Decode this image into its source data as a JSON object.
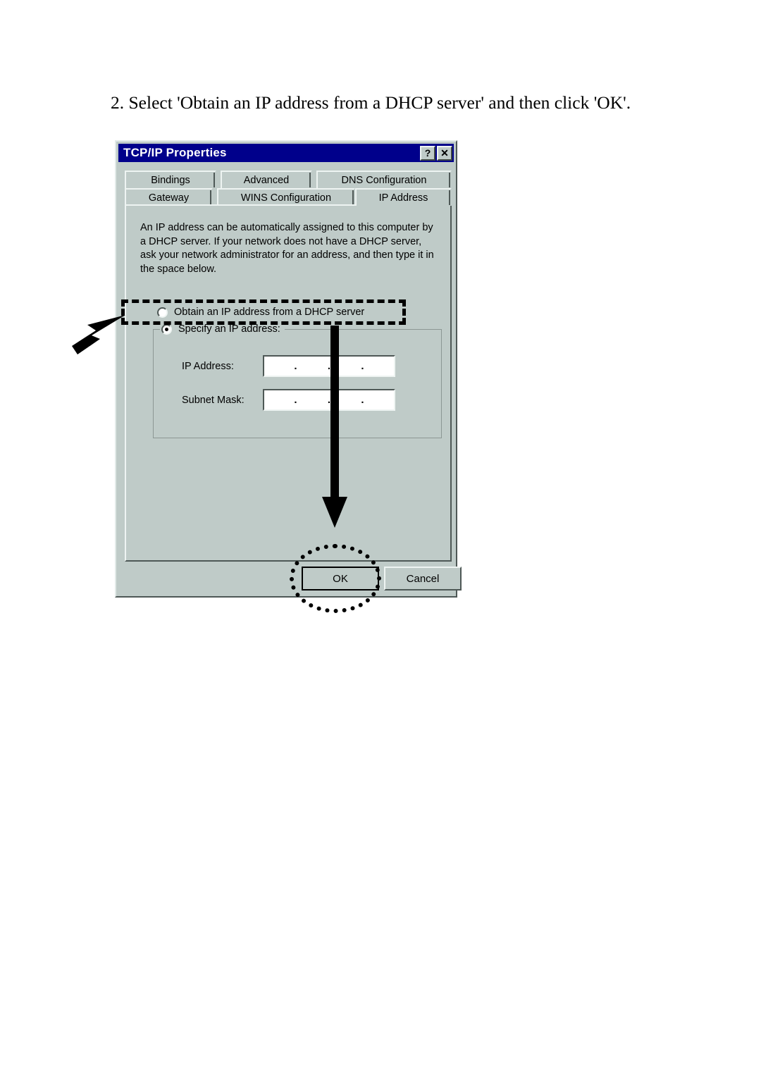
{
  "page": {
    "instruction": "2. Select 'Obtain an IP address from a DHCP server' and then click 'OK'."
  },
  "dialog": {
    "title": "TCP/IP Properties",
    "titlebar_buttons": [
      {
        "name": "help-button",
        "glyph": "?"
      },
      {
        "name": "close-button",
        "glyph": "✕"
      }
    ],
    "tabs": {
      "row1": [
        {
          "label": "Bindings",
          "active": false
        },
        {
          "label": "Advanced",
          "active": false
        },
        {
          "label": "DNS Configuration",
          "active": false
        }
      ],
      "row2": [
        {
          "label": "Gateway",
          "active": false
        },
        {
          "label": "WINS Configuration",
          "active": false
        },
        {
          "label": "IP Address",
          "active": true
        }
      ],
      "selected": "IP Address"
    },
    "description": "An IP address can be automatically assigned to this computer by a DHCP server. If your network does not have a DHCP server, ask your network administrator for an address, and then type it in the space below.",
    "options": {
      "dhcp": {
        "label_prefix": "",
        "label": "Obtain an IP address from a DHCP server",
        "accelerator": "O",
        "selected": false
      },
      "specify": {
        "label": "Specify an IP address:",
        "accelerator": "S",
        "selected": true
      }
    },
    "fields": [
      {
        "name": "ip-address-field",
        "label": "IP Address:",
        "accelerator": "I",
        "value": "",
        "octets": [
          "",
          "",
          "",
          ""
        ],
        "separator": "."
      },
      {
        "name": "subnet-mask-field",
        "label": "Subnet Mask:",
        "accelerator": "u",
        "value": "",
        "octets": [
          "",
          "",
          "",
          ""
        ],
        "separator": "."
      }
    ],
    "buttons": {
      "ok": "OK",
      "cancel": "Cancel"
    }
  },
  "annotations": {
    "dhcp_box": "dashed-highlight-rectangle",
    "ok_ellipse": "dotted-highlight-ellipse",
    "arrow_left": "arrow-pointing-to-dhcp-option",
    "arrow_down": "arrow-pointing-to-ok-button"
  },
  "colors": {
    "titlebar": "#00008b",
    "dialog_face": "#bfcbc8",
    "title_text": "#ffffff",
    "body_text": "#000000",
    "field_background": "#ffffff",
    "annotation": "#000000",
    "page_background": "#ffffff"
  }
}
